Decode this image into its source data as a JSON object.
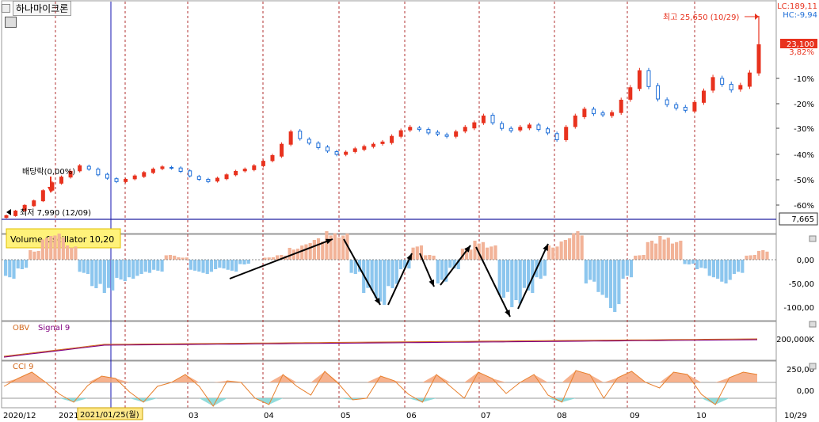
{
  "app": {
    "title": "하나마이크론"
  },
  "price_panel": {
    "lc": "LC:189,11",
    "hc": "HC:-9,94",
    "high_label": "최고 25,650 (10/29)",
    "low_label": "최저 7,990 (12/09)",
    "dividend_label": "배당락(0,00%)",
    "current_price": "23,100",
    "current_pct": "3,82%",
    "line_value": "7,665",
    "pct_ticks": [
      "-10%",
      "-20%",
      "-30%",
      "-40%",
      "-50%",
      "-60%"
    ]
  },
  "vo_panel": {
    "title": "Volume Oscillator 10,20",
    "ticks": [
      "0,00",
      "-50,00",
      "-100,00"
    ]
  },
  "obv_panel": {
    "title_obv": "OBV",
    "title_signal": "Signal 9",
    "ticks": [
      "200,000K"
    ]
  },
  "cci_panel": {
    "title": "CCI 9",
    "ticks": [
      "250,00",
      "0,00"
    ]
  },
  "x_axis": {
    "labels": [
      "2020/12",
      "2021/",
      "03",
      "04",
      "05",
      "06",
      "07",
      "08",
      "09",
      "10",
      "10/29"
    ],
    "cursor_date": "2021/01/25(월)"
  },
  "colors": {
    "up": "#e8321e",
    "down": "#1f6fd8",
    "vo_pos": "#f2b398",
    "vo_neg": "#8cc6ee",
    "obv": "#d2691e",
    "signal": "#800080",
    "cci": "#e8802e",
    "cci_fill": "#f4a47a",
    "cci_neg_fill": "#7fd6d6",
    "grid_month": "#b03030",
    "cursor": "#1010b0",
    "baseline": "#2020a0",
    "highlight": "#fff27a"
  },
  "chart_data": {
    "type": "candlestick",
    "title": "하나마이크론",
    "x_range": [
      "2020/12",
      "2021/10/29"
    ],
    "price_high": 25650,
    "price_low": 7990,
    "last_close": 23100,
    "last_change_pct": 3.82,
    "horizontal_line": 7665,
    "approx_closes": [
      7990,
      8400,
      8900,
      9300,
      10200,
      10900,
      11400,
      11900,
      12400,
      12100,
      11600,
      11300,
      11000,
      11200,
      11500,
      11800,
      12100,
      12300,
      12200,
      11900,
      11500,
      11200,
      11000,
      11300,
      11600,
      11900,
      12100,
      12400,
      12800,
      13300,
      14300,
      15400,
      14800,
      14400,
      14000,
      13700,
      13400,
      13600,
      13900,
      14100,
      14300,
      14500,
      15000,
      15500,
      15800,
      15600,
      15300,
      15200,
      15000,
      15400,
      15800,
      16200,
      16800,
      16200,
      15700,
      15500,
      15800,
      16000,
      15600,
      15300,
      14700,
      15800,
      16800,
      17400,
      17000,
      16900,
      17100,
      18200,
      19300,
      20800,
      19400,
      18300,
      17800,
      17500,
      17300,
      18000,
      19000,
      20200,
      19600,
      19100,
      19500,
      20600,
      23100
    ],
    "volume_oscillator_approx": [
      -40,
      -20,
      20,
      50,
      55,
      30,
      -30,
      -60,
      -70,
      -45,
      -40,
      -30,
      -25,
      10,
      5,
      -25,
      -30,
      -20,
      -25,
      -10,
      0,
      5,
      10,
      25,
      35,
      45,
      60,
      55,
      -30,
      -70,
      -95,
      -60,
      -20,
      30,
      10,
      -50,
      -20,
      25,
      40,
      30,
      -80,
      -100,
      -70,
      -40,
      30,
      45,
      60,
      -50,
      -80,
      -110,
      -40,
      10,
      40,
      50,
      40,
      -10,
      -20,
      -40,
      -50,
      -30,
      10,
      20
    ],
    "cci_approx": [
      50,
      150,
      230,
      100,
      -50,
      -150,
      60,
      180,
      150,
      -20,
      -150,
      50,
      100,
      200,
      50,
      -200,
      120,
      100,
      -100,
      -180,
      200,
      50,
      -60,
      240,
      80,
      -120,
      -100,
      180,
      120,
      -50,
      -150,
      200,
      50,
      -100,
      230,
      150,
      -40,
      100,
      200,
      -60,
      -150,
      250,
      200,
      -100,
      160,
      240,
      100,
      30,
      230,
      200,
      -50,
      -180,
      160,
      230,
      200
    ]
  }
}
